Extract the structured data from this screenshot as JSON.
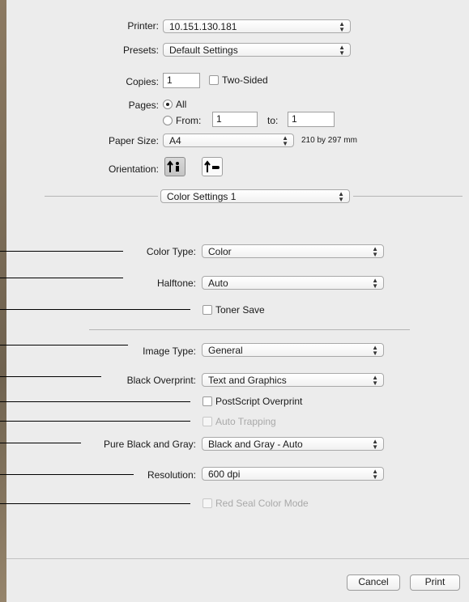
{
  "print_panel": {
    "printer": {
      "label": "Printer:",
      "value": "10.151.130.181"
    },
    "presets": {
      "label": "Presets:",
      "value": "Default Settings"
    },
    "copies": {
      "label": "Copies:",
      "value": "1",
      "two_sided_label": "Two-Sided"
    },
    "pages": {
      "label": "Pages:",
      "all_label": "All",
      "from_label": "From:",
      "from_value": "1",
      "to_label": "to:",
      "to_value": "1"
    },
    "paper_size": {
      "label": "Paper Size:",
      "value": "A4",
      "dimensions": "210 by 297 mm"
    },
    "orientation": {
      "label": "Orientation:"
    },
    "section": {
      "value": "Color Settings 1"
    }
  },
  "color_settings": {
    "color_type": {
      "label": "Color Type:",
      "value": "Color"
    },
    "halftone": {
      "label": "Halftone:",
      "value": "Auto"
    },
    "toner_save": {
      "label": "Toner Save"
    },
    "image_type": {
      "label": "Image Type:",
      "value": "General"
    },
    "black_overprint": {
      "label": "Black Overprint:",
      "value": "Text and Graphics"
    },
    "postscript_overprint": {
      "label": "PostScript Overprint"
    },
    "auto_trapping": {
      "label": "Auto Trapping"
    },
    "pure_black_gray": {
      "label": "Pure Black and Gray:",
      "value": "Black and Gray - Auto"
    },
    "resolution": {
      "label": "Resolution:",
      "value": "600 dpi"
    },
    "red_seal": {
      "label": "Red Seal Color Mode"
    }
  },
  "footer": {
    "cancel_label": "Cancel",
    "print_label": "Print"
  }
}
